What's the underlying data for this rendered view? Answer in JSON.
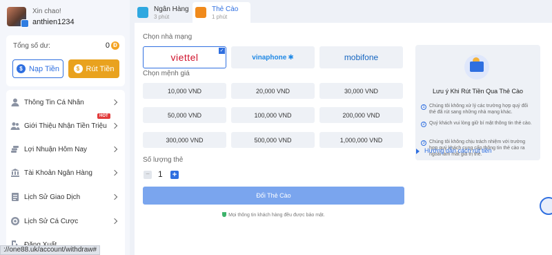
{
  "profile": {
    "greeting": "Xin chao!",
    "username": "anthien1234"
  },
  "balance": {
    "label": "Tổng số dư:",
    "value": "0",
    "coin_symbol": "Đ"
  },
  "actions": {
    "deposit_label": "Nạp Tiền",
    "withdraw_label": "Rút Tiền",
    "currency_glyph": "$"
  },
  "menu": {
    "items": [
      {
        "label": "Thông Tin Cá Nhân",
        "icon": "user-icon"
      },
      {
        "label": "Giới Thiệu Nhận Tiền Triệu",
        "icon": "users-icon",
        "badge": "HOT"
      },
      {
        "label": "Lợi Nhuận Hôm Nay",
        "icon": "coins-icon"
      },
      {
        "label": "Tài Khoản Ngân Hàng",
        "icon": "bank-icon"
      },
      {
        "label": "Lịch Sử Giao Dịch",
        "icon": "history-icon"
      },
      {
        "label": "Lịch Sử Cá Cược",
        "icon": "bet-icon"
      },
      {
        "label": "Đăng Xuất",
        "icon": "logout-icon"
      }
    ]
  },
  "status_url": "://one88.uk/account/withdraw#",
  "tabs": [
    {
      "title": "Ngân Hàng",
      "sub": "3 phút",
      "color": "#2fa8e0"
    },
    {
      "title": "Thẻ Cào",
      "sub": "1 phút",
      "color": "#f08a1c"
    }
  ],
  "form": {
    "carrier_label": "Chọn nhà mạng",
    "carriers": [
      {
        "name": "viettel",
        "color": "#d0112b"
      },
      {
        "name": "vinaphone",
        "color": "#1e88e5"
      },
      {
        "name": "mobifone",
        "color": "#1565c0"
      }
    ],
    "selected_carrier": "viettel",
    "check_glyph": "✓",
    "amount_label": "Chọn mệnh giá",
    "amounts": [
      "10,000 VND",
      "20,000 VND",
      "30,000 VND",
      "50,000 VND",
      "100,000 VND",
      "200,000 VND",
      "300,000 VND",
      "500,000 VND",
      "1,000,000 VND"
    ],
    "quantity_label": "Số lượng thẻ",
    "quantity": "1",
    "minus_glyph": "−",
    "plus_glyph": "+",
    "submit_label": "Đổi Thẻ Cào",
    "secure_note": "Mọi thông tin khách hàng đều được bảo mật."
  },
  "notice": {
    "title": "Lưu ý Khi Rút Tiền Qua Thẻ Cào",
    "items": [
      {
        "num": "1",
        "text": "Chúng tôi không xử lý các trường hợp quý đổi thẻ đã rút sang những nhà mạng khác."
      },
      {
        "num": "2",
        "text": "Quý khách vui lòng giữ bí mật thông tin thẻ cào."
      },
      {
        "num": "3",
        "text": "Chúng tôi không chịu trách nhiệm với trường hợp quý khách cung cấp thông tin thẻ cào ra ngoài làm mất giá trị thẻ."
      }
    ]
  },
  "guide_link": "Hướng dẫn cách rút tiền"
}
